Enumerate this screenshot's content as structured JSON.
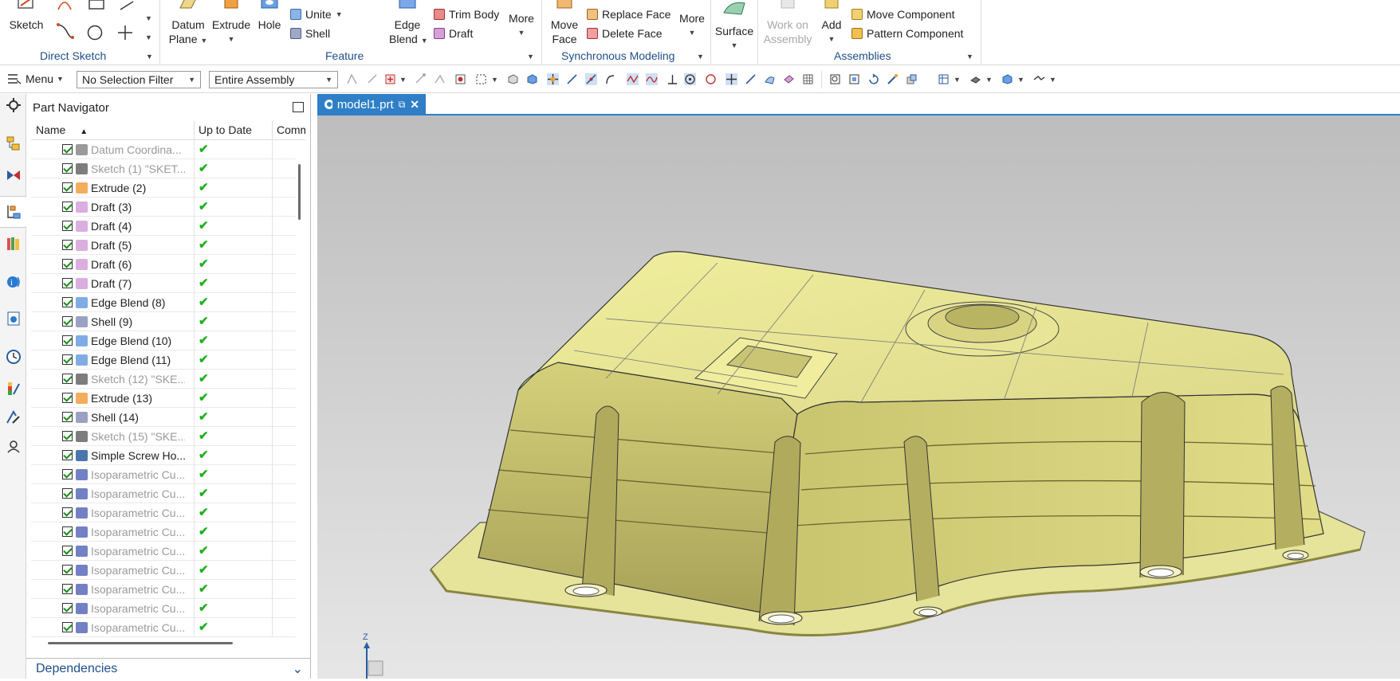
{
  "ribbon": {
    "sketch_label": "Sketch",
    "datum_plane_line1": "Datum",
    "datum_plane_line2": "Plane",
    "extrude_label": "Extrude",
    "hole_label": "Hole",
    "unite_label": "Unite",
    "shell_label": "Shell",
    "edge_blend_line1": "Edge",
    "edge_blend_line2": "Blend",
    "trim_body_label": "Trim Body",
    "draft_label": "Draft",
    "more_label": "More",
    "move_face_line1": "Move",
    "move_face_line2": "Face",
    "replace_face_label": "Replace Face",
    "delete_face_label": "Delete Face",
    "more2_label": "More",
    "surface_label": "Surface",
    "work_on_line1": "Work on",
    "work_on_line2": "Assembly",
    "add_label": "Add",
    "move_component_label": "Move Component",
    "pattern_component_label": "Pattern Component",
    "groups": {
      "direct_sketch": "Direct Sketch",
      "feature": "Feature",
      "synchronous_modeling": "Synchronous Modeling",
      "assemblies": "Assemblies"
    }
  },
  "toolbar": {
    "menu_label": "Menu",
    "selection_filter": "No Selection Filter",
    "scope": "Entire Assembly"
  },
  "navigator": {
    "title": "Part Navigator",
    "columns": {
      "name": "Name",
      "uptodate": "Up to Date",
      "comment": "Comm"
    },
    "rows": [
      {
        "name": "Datum Coordina...",
        "dim": true,
        "icon": "datum-csys-icon"
      },
      {
        "name": "Sketch (1) \"SKET...",
        "dim": true,
        "icon": "sketch-icon"
      },
      {
        "name": "Extrude (2)",
        "dim": false,
        "icon": "extrude-icon"
      },
      {
        "name": "Draft (3)",
        "dim": false,
        "icon": "draft-icon"
      },
      {
        "name": "Draft (4)",
        "dim": false,
        "icon": "draft-icon"
      },
      {
        "name": "Draft (5)",
        "dim": false,
        "icon": "draft-icon"
      },
      {
        "name": "Draft (6)",
        "dim": false,
        "icon": "draft-icon"
      },
      {
        "name": "Draft (7)",
        "dim": false,
        "icon": "draft-icon"
      },
      {
        "name": "Edge Blend (8)",
        "dim": false,
        "icon": "edge-blend-icon"
      },
      {
        "name": "Shell (9)",
        "dim": false,
        "icon": "shell-icon"
      },
      {
        "name": "Edge Blend (10)",
        "dim": false,
        "icon": "edge-blend-icon"
      },
      {
        "name": "Edge Blend (11)",
        "dim": false,
        "icon": "edge-blend-icon"
      },
      {
        "name": "Sketch (12) \"SKE...",
        "dim": true,
        "icon": "sketch-icon"
      },
      {
        "name": "Extrude (13)",
        "dim": false,
        "icon": "extrude-icon"
      },
      {
        "name": "Shell (14)",
        "dim": false,
        "icon": "shell-icon"
      },
      {
        "name": "Sketch (15) \"SKE...",
        "dim": true,
        "icon": "sketch-icon"
      },
      {
        "name": "Simple Screw Ho...",
        "dim": false,
        "icon": "screw-hole-icon"
      },
      {
        "name": "Isoparametric Cu...",
        "dim": true,
        "icon": "isoparametric-curve-icon"
      },
      {
        "name": "Isoparametric Cu...",
        "dim": true,
        "icon": "isoparametric-curve-icon"
      },
      {
        "name": "Isoparametric Cu...",
        "dim": true,
        "icon": "isoparametric-curve-icon"
      },
      {
        "name": "Isoparametric Cu...",
        "dim": true,
        "icon": "isoparametric-curve-icon"
      },
      {
        "name": "Isoparametric Cu...",
        "dim": true,
        "icon": "isoparametric-curve-icon"
      },
      {
        "name": "Isoparametric Cu...",
        "dim": true,
        "icon": "isoparametric-curve-icon"
      },
      {
        "name": "Isoparametric Cu...",
        "dim": true,
        "icon": "isoparametric-curve-icon"
      },
      {
        "name": "Isoparametric Cu...",
        "dim": true,
        "icon": "isoparametric-curve-icon"
      },
      {
        "name": "Isoparametric Cu...",
        "dim": true,
        "icon": "isoparametric-curve-icon"
      }
    ],
    "dependencies_label": "Dependencies"
  },
  "viewport": {
    "tab_label": "model1.prt",
    "axis_label": "Z",
    "model_color": "#e3e29a"
  }
}
